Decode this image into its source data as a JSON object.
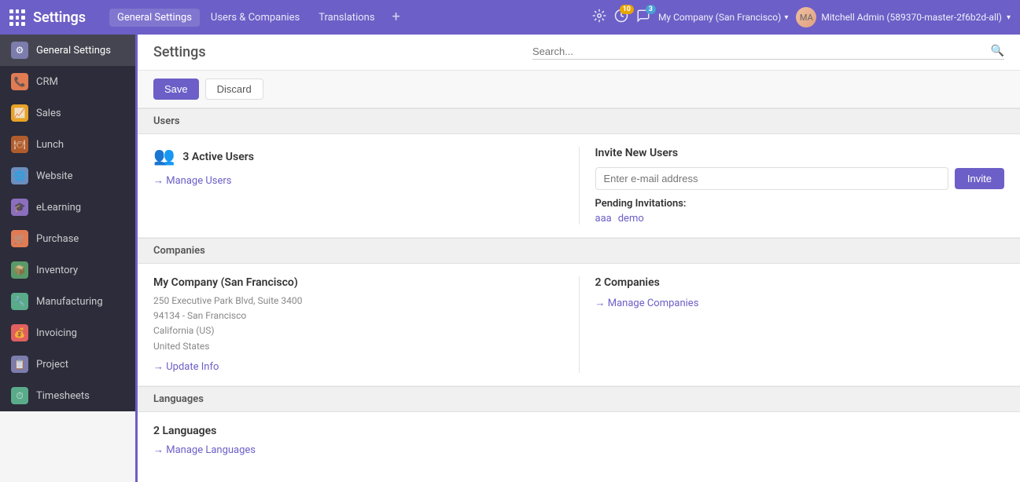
{
  "navbar": {
    "grid_icon_label": "menu",
    "title": "Settings",
    "links": [
      {
        "label": "General Settings",
        "active": true
      },
      {
        "label": "Users & Companies",
        "active": false
      },
      {
        "label": "Translations",
        "active": false
      }
    ],
    "plus_label": "+",
    "notifications": {
      "activity_count": "10",
      "message_count": "3"
    },
    "company": "My Company (San Francisco)",
    "user": "Mitchell Admin (589370-master-2f6b2d-all)"
  },
  "page": {
    "title": "Settings",
    "search_placeholder": "Search..."
  },
  "actions": {
    "save_label": "Save",
    "discard_label": "Discard"
  },
  "sidebar": {
    "items": [
      {
        "id": "general-settings",
        "label": "General Settings",
        "icon": "⚙",
        "icon_class": "icon-general",
        "active": true
      },
      {
        "id": "crm",
        "label": "CRM",
        "icon": "📞",
        "icon_class": "icon-crm",
        "active": false
      },
      {
        "id": "sales",
        "label": "Sales",
        "icon": "📈",
        "icon_class": "icon-sales",
        "active": false
      },
      {
        "id": "lunch",
        "label": "Lunch",
        "icon": "🍽",
        "icon_class": "icon-lunch",
        "active": false
      },
      {
        "id": "website",
        "label": "Website",
        "icon": "🌐",
        "icon_class": "icon-website",
        "active": false
      },
      {
        "id": "elearning",
        "label": "eLearning",
        "icon": "🎓",
        "icon_class": "icon-elearning",
        "active": false
      },
      {
        "id": "purchase",
        "label": "Purchase",
        "icon": "🛒",
        "icon_class": "icon-purchase",
        "active": false
      },
      {
        "id": "inventory",
        "label": "Inventory",
        "icon": "📦",
        "icon_class": "icon-inventory",
        "active": false
      },
      {
        "id": "manufacturing",
        "label": "Manufacturing",
        "icon": "🔧",
        "icon_class": "icon-manufacturing",
        "active": false
      },
      {
        "id": "invoicing",
        "label": "Invoicing",
        "icon": "💰",
        "icon_class": "icon-invoicing",
        "active": false
      },
      {
        "id": "project",
        "label": "Project",
        "icon": "📋",
        "icon_class": "icon-project",
        "active": false
      },
      {
        "id": "timesheets",
        "label": "Timesheets",
        "icon": "⏱",
        "icon_class": "icon-timesheets",
        "active": false
      }
    ]
  },
  "sections": {
    "users": {
      "header": "Users",
      "active_users_count": "3 Active Users",
      "manage_users_link": "→ Manage Users",
      "invite_title": "Invite New Users",
      "invite_placeholder": "Enter e-mail address",
      "invite_button": "Invite",
      "pending_label": "Pending Invitations:",
      "pending_invites": [
        "aaa",
        "demo"
      ]
    },
    "companies": {
      "header": "Companies",
      "company_name": "My Company (San Francisco)",
      "address_line1": "250 Executive Park Blvd, Suite 3400",
      "address_line2": "94134 - San Francisco",
      "address_line3": "California (US)",
      "address_line4": "United States",
      "update_link": "→ Update Info",
      "companies_count": "2 Companies",
      "manage_companies_link": "→ Manage Companies"
    },
    "languages": {
      "header": "Languages",
      "count": "2 Languages",
      "manage_link": "→ Manage Languages"
    }
  }
}
